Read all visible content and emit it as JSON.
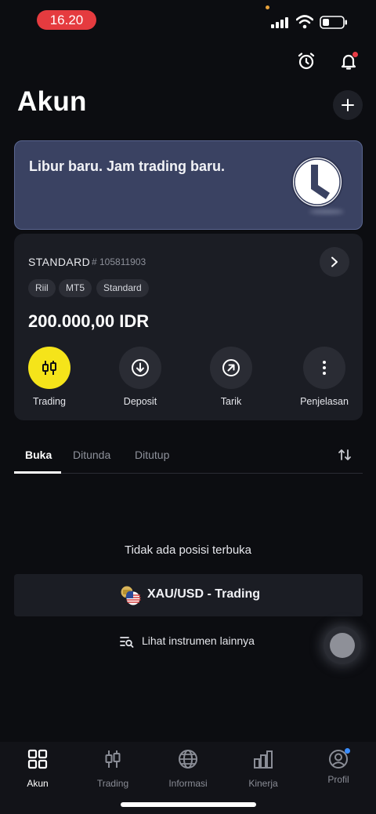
{
  "status_bar": {
    "time": "16.20"
  },
  "header": {
    "title": "Akun"
  },
  "banner": {
    "text": "Libur baru. Jam trading baru."
  },
  "account": {
    "type": "STANDARD",
    "number": "# 105811903",
    "tags": [
      "Riil",
      "MT5",
      "Standard"
    ],
    "balance": "200.000,00 IDR",
    "actions": [
      {
        "label": "Trading",
        "icon": "candlestick-icon"
      },
      {
        "label": "Deposit",
        "icon": "arrow-down-circle-icon"
      },
      {
        "label": "Tarik",
        "icon": "arrow-up-right-circle-icon"
      },
      {
        "label": "Penjelasan",
        "icon": "more-vertical-icon"
      }
    ]
  },
  "tabs": [
    "Buka",
    "Ditunda",
    "Ditutup"
  ],
  "positions": {
    "empty_text": "Tidak ada posisi terbuka",
    "instrument_label": "XAU/USD - Trading",
    "more_link": "Lihat instrumen lainnya"
  },
  "bottom_nav": [
    {
      "label": "Akun",
      "icon": "grid-icon"
    },
    {
      "label": "Trading",
      "icon": "candlestick-icon"
    },
    {
      "label": "Informasi",
      "icon": "globe-icon"
    },
    {
      "label": "Kinerja",
      "icon": "bar-chart-icon"
    },
    {
      "label": "Profil",
      "icon": "profile-icon"
    }
  ],
  "colors": {
    "background": "#0c0d11",
    "card": "#1b1d24",
    "banner": "#3a4262",
    "accent_yellow": "#f5e41a",
    "status_pill": "#e53b3f",
    "notification_dot": "#ea3b45",
    "profile_dot": "#3a8dff"
  }
}
